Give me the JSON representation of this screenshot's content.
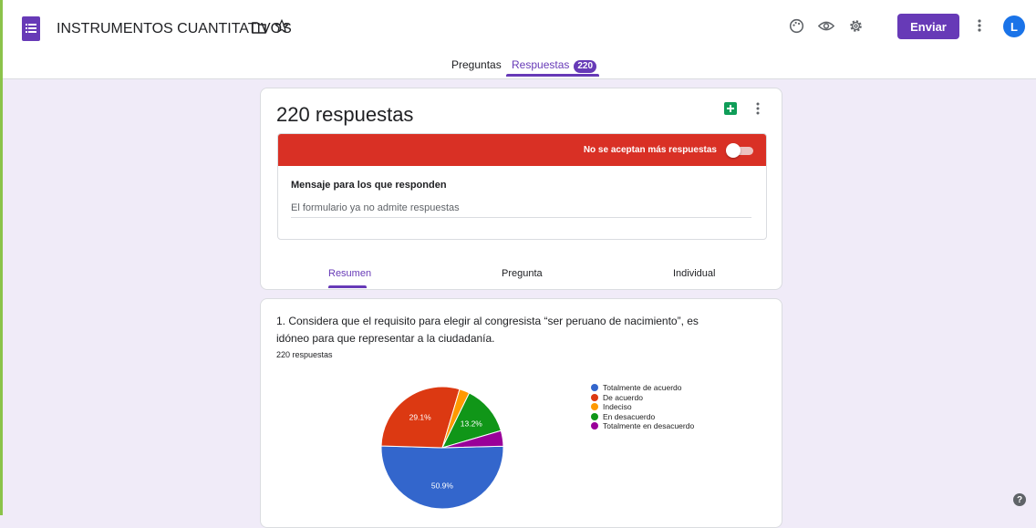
{
  "header": {
    "title": "INSTRUMENTOS CUANTITATIVOS",
    "send_label": "Enviar",
    "avatar_initial": "L",
    "tabs": [
      {
        "label": "Preguntas"
      },
      {
        "label": "Respuestas",
        "badge": "220"
      }
    ]
  },
  "responses": {
    "title": "220 respuestas",
    "closed_text": "No se aceptan más respuestas",
    "message_label": "Mensaje para los que responden",
    "message_value": "El formulario ya no admite respuestas",
    "subtabs": [
      "Resumen",
      "Pregunta",
      "Individual"
    ]
  },
  "question": {
    "text": "1. Considera que el requisito para elegir al congresista “ser peruano de nacimiento”, es idóneo para que representar a la ciudadanía.",
    "count": "220 respuestas"
  },
  "chart_data": {
    "type": "pie",
    "categories": [
      "Totalmente de acuerdo",
      "De acuerdo",
      "Indeciso",
      "En desacuerdo",
      "Totalmente en desacuerdo"
    ],
    "values": [
      50.9,
      29.1,
      2.7,
      13.2,
      4.1
    ],
    "data_labels": [
      "50.9%",
      "29.1%",
      "",
      "13.2%",
      ""
    ],
    "colors": [
      "#3366cc",
      "#dc3912",
      "#ff9900",
      "#109618",
      "#990099"
    ],
    "legend_position": "right"
  },
  "colors": {
    "accent": "#673ab7",
    "closed_banner": "#d93025",
    "background": "#f0ebf8"
  },
  "icons": [
    "forms-app-icon",
    "folder-icon",
    "star-icon",
    "palette-icon",
    "preview-eye-icon",
    "settings-gear-icon",
    "more-vert-icon",
    "sheets-icon",
    "help-icon"
  ],
  "help_glyph": "?"
}
